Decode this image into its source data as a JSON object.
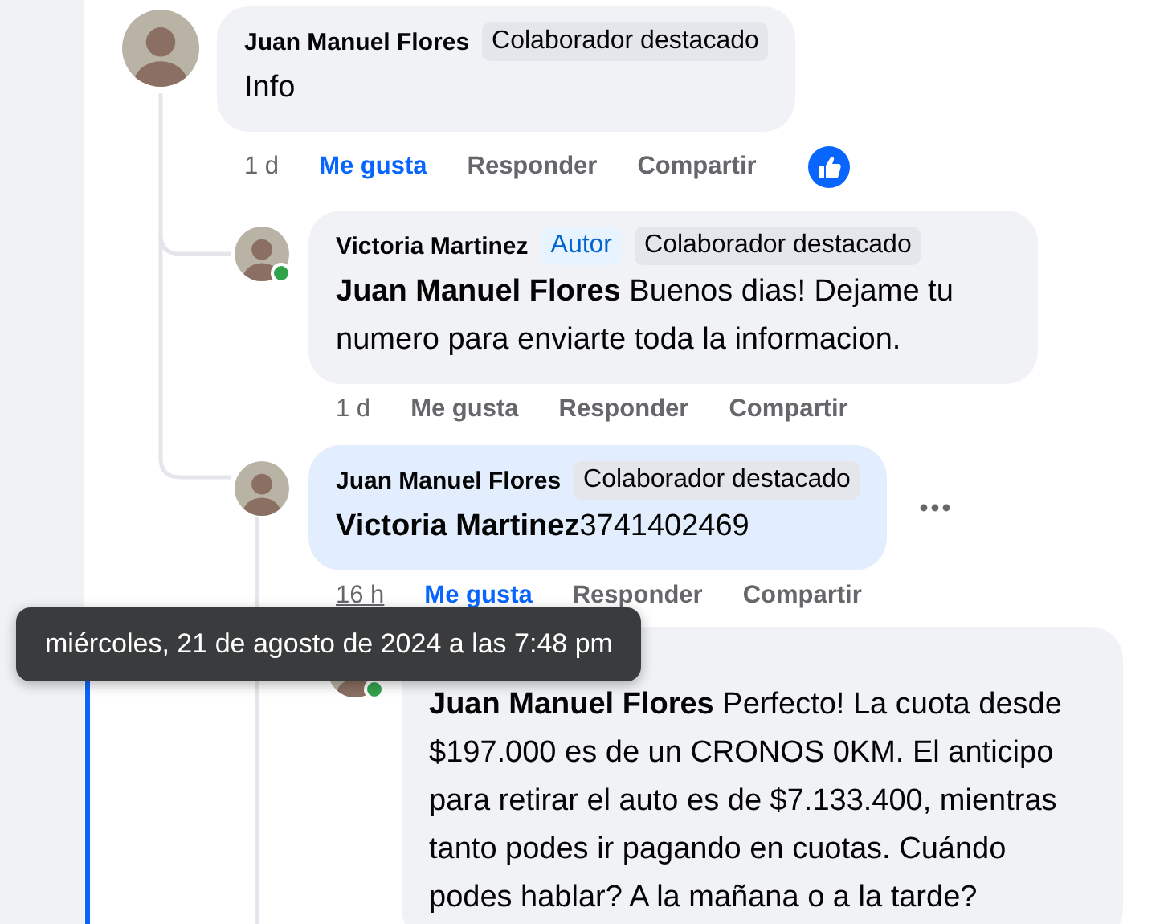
{
  "comments": [
    {
      "author": "Juan Manuel Flores",
      "online": false,
      "highlighted": false,
      "badges": [
        {
          "kind": "top",
          "label": "Colaborador destacado"
        }
      ],
      "text": "Info",
      "time": "1 d",
      "time_hovered": false,
      "like": "Me gusta",
      "liked": true,
      "reply": "Responder",
      "share": "Compartir",
      "reacted": true,
      "more_menu": false,
      "replies": [
        {
          "author": "Victoria Martinez",
          "online": true,
          "highlighted": false,
          "badges": [
            {
              "kind": "author",
              "label": "Autor"
            },
            {
              "kind": "top",
              "label": "Colaborador destacado"
            }
          ],
          "text": "**Juan Manuel Flores** Buenos dias! Dejame tu numero para enviarte toda la informacion.",
          "time": "1 d",
          "time_hovered": false,
          "like": "Me gusta",
          "liked": false,
          "reply": "Responder",
          "share": "Compartir",
          "reacted": false,
          "more_menu": false
        },
        {
          "author": "Juan Manuel Flores",
          "online": false,
          "highlighted": true,
          "badges": [
            {
              "kind": "top",
              "label": "Colaborador destacado"
            }
          ],
          "text": "**Victoria Martinez**3741402469",
          "time": "16 h",
          "time_hovered": true,
          "like": "Me gusta",
          "liked": true,
          "reply": "Responder",
          "share": "Compartir",
          "reacted": false,
          "more_menu": true,
          "replies": [
            {
              "online": true,
              "highlighted": false,
              "text": "**Juan Manuel Flores** Perfecto! La cuota desde $197.000 es de un CRONOS 0KM. El anticipo para retirar el auto es de $7.133.400, mientras tanto podes ir pagando en cuotas. Cuándo podes hablar? A la mañana o a la tarde?",
              "more_menu": false
            }
          ]
        }
      ]
    }
  ],
  "tooltip": {
    "text": "miércoles, 21 de agosto de 2024 a las 7:48 pm"
  }
}
